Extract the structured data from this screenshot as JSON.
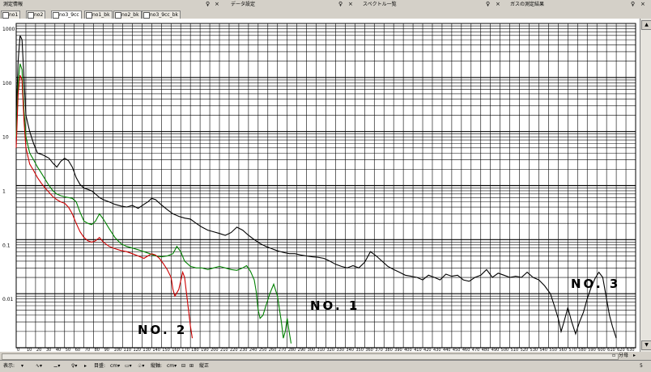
{
  "title_bar": {
    "panes": [
      {
        "label": "測定情報",
        "x": 4
      },
      {
        "label": "データ設定",
        "x": 285
      },
      {
        "label": "スペクトル一覧",
        "x": 448
      },
      {
        "label": "ガスの測定結果",
        "x": 630
      }
    ],
    "pin_glyph": "♀",
    "close_glyph": "×"
  },
  "tabs": [
    {
      "label": "no1"
    },
    {
      "label": "no2"
    },
    {
      "label": "no3_9cc"
    },
    {
      "label": "no1_bk"
    },
    {
      "label": "no2_bk"
    },
    {
      "label": "no3_9cc_bk"
    }
  ],
  "chart_data": {
    "type": "line",
    "y_scale": "log",
    "ylim": [
      0.001,
      1000
    ],
    "y_tick_labels": [
      "1000",
      "100",
      "10",
      "1",
      "0.1",
      "0.01"
    ],
    "xlim": [
      0,
      640
    ],
    "x_tick_labels": [
      "0",
      "10",
      "20",
      "30",
      "40",
      "50",
      "60",
      "70",
      "80",
      "90",
      "100",
      "110",
      "120",
      "130",
      "140",
      "150",
      "160",
      "170",
      "180",
      "190",
      "200",
      "210",
      "220",
      "230",
      "240",
      "250",
      "260",
      "270",
      "280",
      "290",
      "300",
      "310",
      "320",
      "330",
      "340",
      "350",
      "360",
      "370",
      "380",
      "390",
      "400",
      "410",
      "420",
      "430",
      "440",
      "450",
      "460",
      "470",
      "480",
      "490",
      "500",
      "510",
      "520",
      "530",
      "540",
      "550",
      "560",
      "570",
      "580",
      "590",
      "600",
      "610",
      "620",
      "630"
    ],
    "annotations": [
      "NO. 1",
      "NO. 2",
      "NO. 3"
    ],
    "series": [
      {
        "id": "no3",
        "color": "#000000",
        "points": [
          [
            0,
            20
          ],
          [
            2,
            200
          ],
          [
            4,
            600
          ],
          [
            6,
            500
          ],
          [
            8,
            100
          ],
          [
            10,
            20
          ],
          [
            14,
            10
          ],
          [
            18,
            6
          ],
          [
            22,
            4
          ],
          [
            26,
            3.8
          ],
          [
            30,
            3.5
          ],
          [
            34,
            3.2
          ],
          [
            38,
            2.6
          ],
          [
            42,
            2.2
          ],
          [
            46,
            2.8
          ],
          [
            50,
            3.2
          ],
          [
            54,
            2.9
          ],
          [
            58,
            2.2
          ],
          [
            62,
            1.4
          ],
          [
            66,
            1.05
          ],
          [
            70,
            0.9
          ],
          [
            74,
            0.85
          ],
          [
            78,
            0.8
          ],
          [
            82,
            0.7
          ],
          [
            86,
            0.6
          ],
          [
            90,
            0.55
          ],
          [
            96,
            0.5
          ],
          [
            102,
            0.45
          ],
          [
            108,
            0.42
          ],
          [
            114,
            0.4
          ],
          [
            120,
            0.43
          ],
          [
            126,
            0.38
          ],
          [
            132,
            0.45
          ],
          [
            136,
            0.5
          ],
          [
            140,
            0.58
          ],
          [
            144,
            0.55
          ],
          [
            150,
            0.44
          ],
          [
            156,
            0.36
          ],
          [
            162,
            0.3
          ],
          [
            168,
            0.27
          ],
          [
            174,
            0.25
          ],
          [
            180,
            0.24
          ],
          [
            186,
            0.2
          ],
          [
            192,
            0.17
          ],
          [
            198,
            0.15
          ],
          [
            204,
            0.14
          ],
          [
            210,
            0.13
          ],
          [
            216,
            0.12
          ],
          [
            222,
            0.135
          ],
          [
            228,
            0.17
          ],
          [
            234,
            0.15
          ],
          [
            240,
            0.12
          ],
          [
            246,
            0.1
          ],
          [
            252,
            0.085
          ],
          [
            258,
            0.075
          ],
          [
            264,
            0.068
          ],
          [
            270,
            0.062
          ],
          [
            276,
            0.058
          ],
          [
            282,
            0.055
          ],
          [
            288,
            0.055
          ],
          [
            294,
            0.052
          ],
          [
            300,
            0.05
          ],
          [
            306,
            0.048
          ],
          [
            312,
            0.047
          ],
          [
            318,
            0.045
          ],
          [
            324,
            0.04
          ],
          [
            330,
            0.035
          ],
          [
            336,
            0.032
          ],
          [
            342,
            0.03
          ],
          [
            348,
            0.033
          ],
          [
            354,
            0.03
          ],
          [
            360,
            0.038
          ],
          [
            366,
            0.06
          ],
          [
            372,
            0.05
          ],
          [
            378,
            0.04
          ],
          [
            384,
            0.032
          ],
          [
            390,
            0.028
          ],
          [
            396,
            0.025
          ],
          [
            402,
            0.022
          ],
          [
            408,
            0.021
          ],
          [
            414,
            0.02
          ],
          [
            420,
            0.018
          ],
          [
            426,
            0.022
          ],
          [
            432,
            0.02
          ],
          [
            438,
            0.018
          ],
          [
            444,
            0.023
          ],
          [
            450,
            0.021
          ],
          [
            456,
            0.022
          ],
          [
            462,
            0.018
          ],
          [
            468,
            0.017
          ],
          [
            474,
            0.02
          ],
          [
            480,
            0.022
          ],
          [
            486,
            0.028
          ],
          [
            492,
            0.02
          ],
          [
            498,
            0.024
          ],
          [
            504,
            0.022
          ],
          [
            510,
            0.02
          ],
          [
            516,
            0.021
          ],
          [
            522,
            0.02
          ],
          [
            528,
            0.025
          ],
          [
            534,
            0.02
          ],
          [
            540,
            0.018
          ],
          [
            546,
            0.014
          ],
          [
            552,
            0.01
          ],
          [
            556,
            0.006
          ],
          [
            560,
            0.0035
          ],
          [
            563,
            0.002
          ],
          [
            566,
            0.003
          ],
          [
            570,
            0.0055
          ],
          [
            574,
            0.003
          ],
          [
            578,
            0.0018
          ],
          [
            582,
            0.003
          ],
          [
            586,
            0.0045
          ],
          [
            590,
            0.008
          ],
          [
            594,
            0.013
          ],
          [
            598,
            0.019
          ],
          [
            602,
            0.025
          ],
          [
            606,
            0.02
          ],
          [
            610,
            0.008
          ],
          [
            613,
            0.004
          ],
          [
            616,
            0.0025
          ],
          [
            620,
            0.0015
          ]
        ]
      },
      {
        "id": "no1",
        "color": "#008000",
        "points": [
          [
            0,
            8
          ],
          [
            2,
            80
          ],
          [
            4,
            180
          ],
          [
            6,
            140
          ],
          [
            8,
            25
          ],
          [
            10,
            8
          ],
          [
            14,
            4
          ],
          [
            18,
            3
          ],
          [
            22,
            2.2
          ],
          [
            26,
            1.7
          ],
          [
            30,
            1.3
          ],
          [
            34,
            1.0
          ],
          [
            38,
            0.8
          ],
          [
            42,
            0.7
          ],
          [
            46,
            0.65
          ],
          [
            50,
            0.62
          ],
          [
            54,
            0.6
          ],
          [
            58,
            0.58
          ],
          [
            62,
            0.5
          ],
          [
            66,
            0.32
          ],
          [
            70,
            0.22
          ],
          [
            74,
            0.2
          ],
          [
            78,
            0.19
          ],
          [
            82,
            0.22
          ],
          [
            86,
            0.3
          ],
          [
            90,
            0.24
          ],
          [
            96,
            0.16
          ],
          [
            102,
            0.11
          ],
          [
            108,
            0.085
          ],
          [
            114,
            0.075
          ],
          [
            120,
            0.07
          ],
          [
            126,
            0.065
          ],
          [
            132,
            0.06
          ],
          [
            138,
            0.055
          ],
          [
            144,
            0.05
          ],
          [
            150,
            0.048
          ],
          [
            156,
            0.05
          ],
          [
            162,
            0.055
          ],
          [
            166,
            0.075
          ],
          [
            170,
            0.06
          ],
          [
            174,
            0.04
          ],
          [
            180,
            0.032
          ],
          [
            186,
            0.03
          ],
          [
            192,
            0.03
          ],
          [
            198,
            0.028
          ],
          [
            204,
            0.03
          ],
          [
            210,
            0.032
          ],
          [
            216,
            0.03
          ],
          [
            222,
            0.028
          ],
          [
            228,
            0.027
          ],
          [
            234,
            0.03
          ],
          [
            238,
            0.033
          ],
          [
            242,
            0.026
          ],
          [
            246,
            0.018
          ],
          [
            248,
            0.011
          ],
          [
            250,
            0.005
          ],
          [
            252,
            0.0035
          ],
          [
            255,
            0.004
          ],
          [
            258,
            0.006
          ],
          [
            262,
            0.01
          ],
          [
            266,
            0.015
          ],
          [
            270,
            0.009
          ],
          [
            274,
            0.003
          ],
          [
            276,
            0.0015
          ],
          [
            278,
            0.002
          ],
          [
            280,
            0.0035
          ],
          [
            282,
            0.002
          ],
          [
            284,
            0.0012
          ]
        ]
      },
      {
        "id": "no2",
        "color": "#cc0000",
        "points": [
          [
            0,
            5
          ],
          [
            2,
            50
          ],
          [
            4,
            110
          ],
          [
            6,
            90
          ],
          [
            8,
            16
          ],
          [
            10,
            5
          ],
          [
            14,
            2.5
          ],
          [
            18,
            1.9
          ],
          [
            22,
            1.4
          ],
          [
            26,
            1.1
          ],
          [
            30,
            0.9
          ],
          [
            34,
            0.75
          ],
          [
            38,
            0.62
          ],
          [
            42,
            0.55
          ],
          [
            46,
            0.5
          ],
          [
            50,
            0.47
          ],
          [
            54,
            0.4
          ],
          [
            58,
            0.3
          ],
          [
            62,
            0.2
          ],
          [
            66,
            0.14
          ],
          [
            70,
            0.11
          ],
          [
            74,
            0.095
          ],
          [
            78,
            0.09
          ],
          [
            82,
            0.095
          ],
          [
            86,
            0.11
          ],
          [
            90,
            0.09
          ],
          [
            96,
            0.075
          ],
          [
            102,
            0.068
          ],
          [
            108,
            0.063
          ],
          [
            114,
            0.06
          ],
          [
            120,
            0.055
          ],
          [
            126,
            0.05
          ],
          [
            132,
            0.045
          ],
          [
            136,
            0.05
          ],
          [
            140,
            0.055
          ],
          [
            144,
            0.052
          ],
          [
            148,
            0.045
          ],
          [
            152,
            0.036
          ],
          [
            156,
            0.028
          ],
          [
            160,
            0.02
          ],
          [
            162,
            0.012
          ],
          [
            164,
            0.009
          ],
          [
            168,
            0.012
          ],
          [
            172,
            0.025
          ],
          [
            174,
            0.02
          ],
          [
            176,
            0.01
          ],
          [
            178,
            0.005
          ],
          [
            180,
            0.0025
          ],
          [
            182,
            0.0015
          ]
        ]
      }
    ],
    "labels": {
      "no1": "NO. 1",
      "no2": "NO. 2",
      "no3": "NO. 3"
    }
  },
  "status_bar": {
    "items": [
      "表示:",
      "▾",
      "∿▾",
      "⚊▾",
      "♀▾",
      "▸",
      "目盛:",
      "cm▾",
      "▭▾",
      "♧▾",
      "縦軸:",
      "cm▾",
      "⊟",
      "⊞",
      "縦正"
    ],
    "right_value": "5"
  },
  "h_scroll_right": {
    "left_label": "▫",
    "middle_label": "分母",
    "right_label": "▸"
  },
  "scroll_glyphs": {
    "up": "▲",
    "down": "▼"
  }
}
